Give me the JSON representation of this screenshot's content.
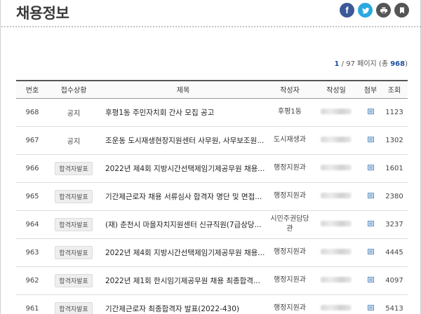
{
  "page": {
    "title": "채용정보"
  },
  "share": {
    "facebook_glyph": "f",
    "colors": {
      "facebook": "#3b5998",
      "twitter": "#29a9e0",
      "print": "#555555",
      "bookmark": "#555555"
    }
  },
  "pagination": {
    "current": "1",
    "separator": "/",
    "total_pages": "97",
    "pages_label": "페이지",
    "count_prefix": "(총",
    "total_count": "968",
    "count_suffix": ")"
  },
  "table": {
    "headers": {
      "no": "번호",
      "status": "접수상황",
      "title": "제목",
      "author": "작성자",
      "date": "작성일",
      "attach": "첨부",
      "views": "조회"
    },
    "rows": [
      {
        "no": "968",
        "status": "공지",
        "status_badge": false,
        "title": "후평1동 주민자치회 간사 모집 공고",
        "author": "후평1동",
        "views": "1123"
      },
      {
        "no": "967",
        "status": "공지",
        "status_badge": false,
        "title": "조운동 도시재생현장지원센터 사무원, 사무보조원...",
        "author": "도시재생과",
        "views": "1302"
      },
      {
        "no": "966",
        "status": "합격자발표",
        "status_badge": true,
        "title": "2022년 제4회 지방시간선택제임기제공무원 채용...",
        "author": "행정지원과",
        "views": "1601"
      },
      {
        "no": "965",
        "status": "합격자발표",
        "status_badge": true,
        "title": "기간제근로자 채용 서류심사 합격자 명단 및 면접...",
        "author": "행정지원과",
        "views": "2380"
      },
      {
        "no": "964",
        "status": "합격자발표",
        "status_badge": true,
        "title": "(재) 춘천시 마을자치지원센터 신규직원(7급상당...",
        "author": "시민주권담당관",
        "views": "3237"
      },
      {
        "no": "963",
        "status": "합격자발표",
        "status_badge": true,
        "title": "2022년 제4회 지방시간선택제임기제공무원 채용...",
        "author": "행정지원과",
        "views": "4445"
      },
      {
        "no": "962",
        "status": "합격자발표",
        "status_badge": true,
        "title": "2022년 제1회 한시임기제공무원 채용 최종합격...",
        "author": "행정지원과",
        "views": "4097"
      },
      {
        "no": "961",
        "status": "합격자발표",
        "status_badge": true,
        "title": "기간제근로자 최종합격자 발표(2022-430)",
        "author": "행정지원과",
        "views": "5413"
      }
    ]
  }
}
